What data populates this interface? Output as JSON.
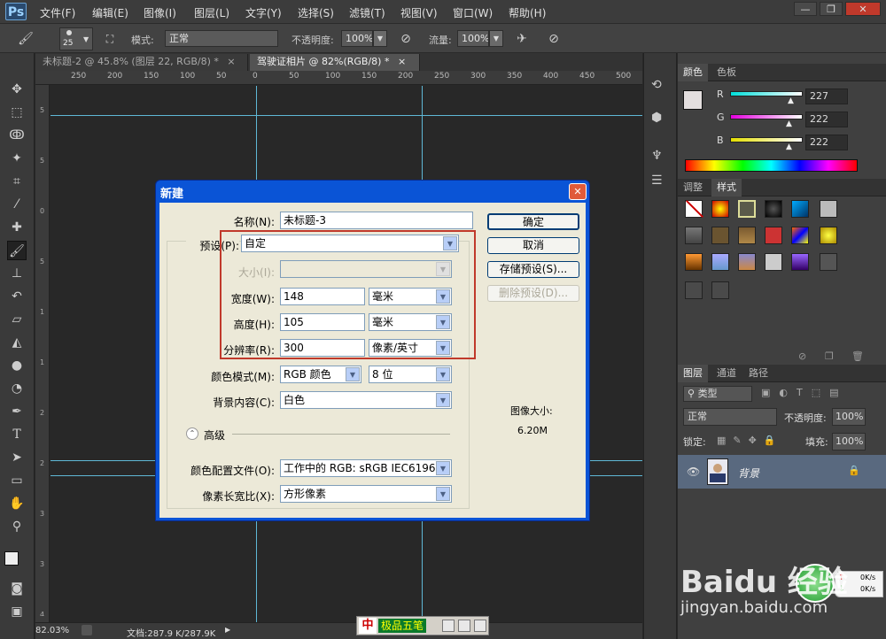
{
  "app": {
    "logo": "Ps"
  },
  "menu": [
    "文件(F)",
    "编辑(E)",
    "图像(I)",
    "图层(L)",
    "文字(Y)",
    "选择(S)",
    "滤镜(T)",
    "视图(V)",
    "窗口(W)",
    "帮助(H)"
  ],
  "window_buttons": [
    "—",
    "❐",
    "✕"
  ],
  "options": {
    "brush_size": "25",
    "mode_label": "模式:",
    "mode_value": "正常",
    "opacity_label": "不透明度:",
    "opacity_value": "100%",
    "flow_label": "流量:",
    "flow_value": "100%"
  },
  "tabs": [
    {
      "label": "未标题-2 @ 45.8% (图层 22, RGB/8) *",
      "close": "×"
    },
    {
      "label": "驾驶证相片 @ 82%(RGB/8) *",
      "close": "×"
    }
  ],
  "ruler_ticks": [
    "250",
    "200",
    "150",
    "100",
    "50",
    "0",
    "50",
    "100",
    "150",
    "200",
    "250",
    "300",
    "350",
    "400",
    "450",
    "500"
  ],
  "status": {
    "zoom": "82.03%",
    "doc": "文档:287.9 K/287.9K"
  },
  "color_panel": {
    "tabs": [
      "颜色",
      "色板"
    ],
    "r_label": "R",
    "g_label": "G",
    "b_label": "B",
    "r": "227",
    "g": "222",
    "b": "222"
  },
  "styles_panel": {
    "tabs": [
      "调整",
      "样式"
    ]
  },
  "layers_panel": {
    "tabs": [
      "图层",
      "通道",
      "路径"
    ],
    "filter_label": "类型",
    "blend_mode": "正常",
    "opacity_label": "不透明度:",
    "opacity_value": "100%",
    "lock_label": "锁定:",
    "fill_label": "填充:",
    "fill_value": "100%",
    "layer_name": "背景"
  },
  "dialog": {
    "title": "新建",
    "close": "✕",
    "name_label": "名称(N):",
    "name_value": "未标题-3",
    "preset_label": "预设(P):",
    "preset_value": "自定",
    "size_label": "大小(I):",
    "size_value": "",
    "width_label": "宽度(W):",
    "width_value": "148",
    "width_unit": "毫米",
    "height_label": "高度(H):",
    "height_value": "105",
    "height_unit": "毫米",
    "res_label": "分辨率(R):",
    "res_value": "300",
    "res_unit": "像素/英寸",
    "color_mode_label": "颜色模式(M):",
    "color_mode_value": "RGB 颜色",
    "bit_depth": "8 位",
    "bg_label": "背景内容(C):",
    "bg_value": "白色",
    "advanced_label": "高级",
    "profile_label": "颜色配置文件(O):",
    "profile_value": "工作中的 RGB: sRGB IEC6196...",
    "aspect_label": "像素长宽比(X):",
    "aspect_value": "方形像素",
    "ok": "确定",
    "cancel": "取消",
    "save_preset": "存储预设(S)...",
    "delete_preset": "删除预设(D)...",
    "image_size_label": "图像大小:",
    "image_size_value": "6.20M"
  },
  "ime": {
    "label": "极品五笔"
  },
  "net": {
    "up": "0K/s",
    "down": "0K/s"
  },
  "watermark": {
    "brand": "Baidu 经验",
    "url": "jingyan.baidu.com"
  }
}
